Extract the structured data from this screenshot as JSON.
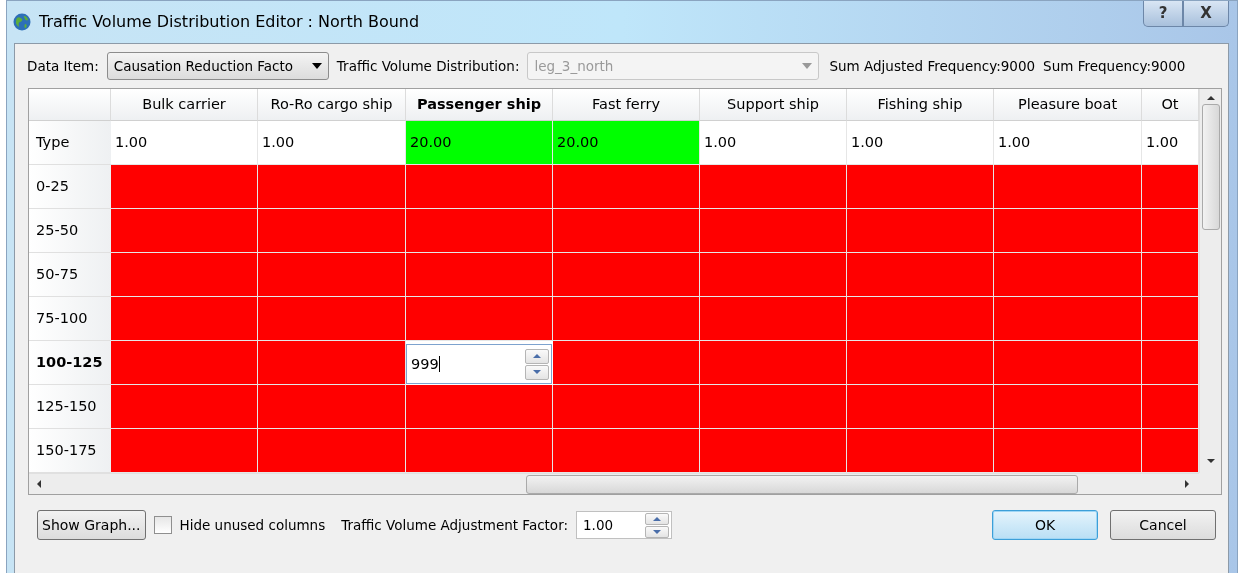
{
  "window": {
    "title": "Traffic Volume Distribution Editor : North Bound",
    "title_buttons": [
      "?",
      "X"
    ]
  },
  "toolbar": {
    "data_item_label": "Data Item:",
    "data_item_value": "Causation Reduction Facto",
    "distribution_label": "Traffic Volume Distribution:",
    "distribution_value": "leg_3_north",
    "distribution_disabled": true,
    "sum_adjusted": "Sum Adjusted Frequency:9000",
    "sum_frequency": "Sum Frequency:9000"
  },
  "table": {
    "columns": [
      {
        "name": "Bulk carrier",
        "selected": false
      },
      {
        "name": "Ro-Ro cargo ship",
        "selected": false
      },
      {
        "name": "Passenger ship",
        "selected": true
      },
      {
        "name": "Fast ferry",
        "selected": false
      },
      {
        "name": "Support ship",
        "selected": false
      },
      {
        "name": "Fishing ship",
        "selected": false
      },
      {
        "name": "Pleasure boat",
        "selected": false
      },
      {
        "name": "Ot",
        "selected": false
      }
    ],
    "rows": [
      {
        "label": "Type",
        "selected": false,
        "cells": [
          {
            "value": "1.00",
            "color": "#ffffff"
          },
          {
            "value": "1.00",
            "color": "#ffffff"
          },
          {
            "value": "20.00",
            "color": "#00ff00"
          },
          {
            "value": "20.00",
            "color": "#00ff00"
          },
          {
            "value": "1.00",
            "color": "#ffffff"
          },
          {
            "value": "1.00",
            "color": "#ffffff"
          },
          {
            "value": "1.00",
            "color": "#ffffff"
          },
          {
            "value": "1.00",
            "color": "#ffffff"
          }
        ]
      },
      {
        "label": "0-25",
        "selected": false,
        "cells": [
          {
            "color": "#ff0000"
          },
          {
            "color": "#ff0000"
          },
          {
            "color": "#ff0000"
          },
          {
            "color": "#ff0000"
          },
          {
            "color": "#ff0000"
          },
          {
            "color": "#ff0000"
          },
          {
            "color": "#ff0000"
          },
          {
            "color": "#ff0000"
          }
        ]
      },
      {
        "label": "25-50",
        "selected": false,
        "cells": [
          {
            "color": "#ff0000"
          },
          {
            "color": "#ff0000"
          },
          {
            "color": "#ff0000"
          },
          {
            "color": "#ff0000"
          },
          {
            "color": "#ff0000"
          },
          {
            "color": "#ff0000"
          },
          {
            "color": "#ff0000"
          },
          {
            "color": "#ff0000"
          }
        ]
      },
      {
        "label": "50-75",
        "selected": false,
        "cells": [
          {
            "color": "#ff0000"
          },
          {
            "color": "#ff0000"
          },
          {
            "color": "#ff0000"
          },
          {
            "color": "#ff0000"
          },
          {
            "color": "#ff0000"
          },
          {
            "color": "#ff0000"
          },
          {
            "color": "#ff0000"
          },
          {
            "color": "#ff0000"
          }
        ]
      },
      {
        "label": "75-100",
        "selected": false,
        "cells": [
          {
            "color": "#ff0000"
          },
          {
            "color": "#ff0000"
          },
          {
            "color": "#ff0000"
          },
          {
            "color": "#ff0000"
          },
          {
            "color": "#ff0000"
          },
          {
            "color": "#ff0000"
          },
          {
            "color": "#ff0000"
          },
          {
            "color": "#ff0000"
          }
        ]
      },
      {
        "label": "100-125",
        "selected": true,
        "cells": [
          {
            "color": "#ff0000"
          },
          {
            "color": "#ff0000"
          },
          {
            "color": "#ffffff",
            "value": "999",
            "editing": true
          },
          {
            "color": "#ff0000"
          },
          {
            "color": "#ff0000"
          },
          {
            "color": "#ff0000"
          },
          {
            "color": "#ff0000"
          },
          {
            "color": "#ff0000"
          }
        ]
      },
      {
        "label": "125-150",
        "selected": false,
        "cells": [
          {
            "color": "#ff0000"
          },
          {
            "color": "#ff0000"
          },
          {
            "color": "#ff0000"
          },
          {
            "color": "#ff0000"
          },
          {
            "color": "#ff0000"
          },
          {
            "color": "#ff0000"
          },
          {
            "color": "#ff0000"
          },
          {
            "color": "#ff0000"
          }
        ]
      },
      {
        "label": "150-175",
        "selected": false,
        "cells": [
          {
            "color": "#ff0000"
          },
          {
            "color": "#ff0000"
          },
          {
            "color": "#ff0000"
          },
          {
            "color": "#ff0000"
          },
          {
            "color": "#ff0000"
          },
          {
            "color": "#ff0000"
          },
          {
            "color": "#ff0000"
          },
          {
            "color": "#ff0000"
          }
        ]
      }
    ]
  },
  "footer": {
    "show_graph": "Show Graph...",
    "hide_unused": {
      "label": "Hide unused columns",
      "checked": false
    },
    "factor_label": "Traffic Volume Adjustment Factor:",
    "factor_value": "1.00",
    "buttons": [
      {
        "label": "OK",
        "default": true
      },
      {
        "label": "Cancel",
        "default": false
      }
    ]
  }
}
